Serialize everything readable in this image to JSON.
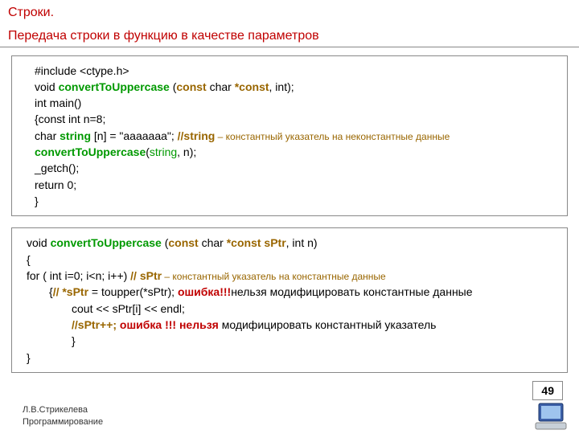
{
  "title": {
    "line1": "Строки.",
    "line2": "Передача строки в функцию в качестве параметров"
  },
  "box1": {
    "l1a": "#include <",
    "l1b": "ctype.h",
    "l1c": ">",
    "l2a": "void ",
    "l2b": "convertToUppercase",
    "l2c": " (",
    "l2d": "const",
    "l2e": " char ",
    "l2f": "*const",
    "l2g": ", int);",
    "l3": "int main()",
    "l4": "{const int n=8;",
    "l5a": "char ",
    "l5b": "string",
    "l5c": " [n] = \"aaaaaaa\";   ",
    "l5d": "//string",
    "l5e": " – константный указатель на неконстантные данные",
    "l6a": "convertToUppercase",
    "l6b": "(",
    "l6c": "string",
    "l6d": ", n);",
    "l7": "_getch();",
    "l8": "return 0;",
    "l9": "}"
  },
  "box2": {
    "l1a": "void ",
    "l1b": "convertToUppercase",
    "l1c": " (",
    "l1d": "const",
    "l1e": " char ",
    "l1f": "*const  sPtr",
    "l1g": ", int n)",
    "l2": "{",
    "l3a": "for ( int i=0; i<n; i++) ",
    "l3b": "// sPtr",
    "l3c": " – константный указатель на константные данные",
    "l4a": "{",
    "l4b": "// *sPtr",
    "l4c": " = toupper(*sPtr); ",
    "l4d": "ошибка!!!",
    "l4e": "нельзя модифицировать константные данные",
    "l5": "cout << sPtr[i] << endl;",
    "l6a": "//sPtr++;",
    "l6b": "  ошибка !!! нельзя",
    "l6c": " модифицировать константный указатель",
    "l7": "}",
    "l8": "}"
  },
  "footer": {
    "l1": "Л.В.Стрикелева",
    "l2": "Программирование"
  },
  "page": "49"
}
